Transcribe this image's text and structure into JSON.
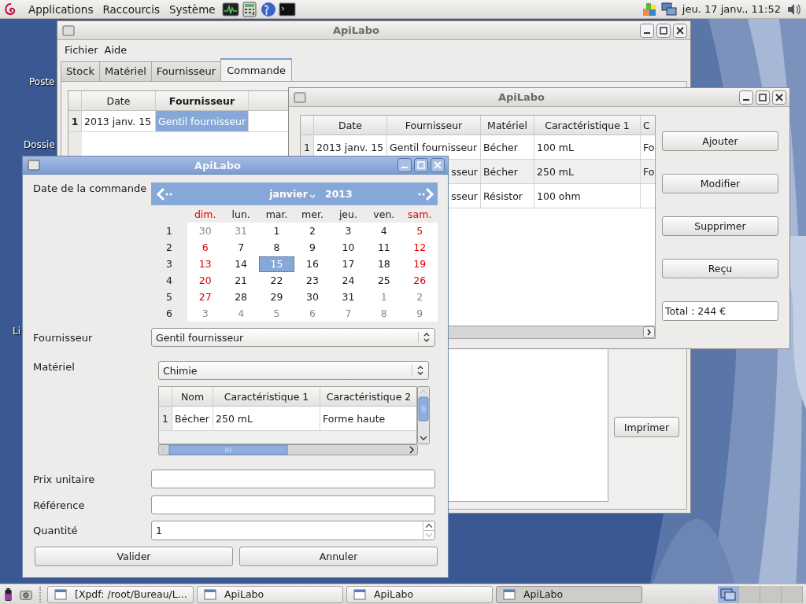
{
  "top_panel": {
    "menus": [
      "Applications",
      "Raccourcis",
      "Système"
    ],
    "clock": "jeu. 17 janv., 11:52"
  },
  "desktop_icons": [
    {
      "label": "Poste"
    },
    {
      "label": "Dossie"
    },
    {
      "label": "Li"
    }
  ],
  "main_window": {
    "title": "ApiLabo",
    "menu": [
      "Fichier",
      "Aide"
    ],
    "tabs": [
      {
        "label": "Stock",
        "selected": false
      },
      {
        "label": "Matériel",
        "selected": false
      },
      {
        "label": "Fournisseur",
        "selected": false
      },
      {
        "label": "Commande",
        "selected": true
      }
    ],
    "table": {
      "columns": [
        {
          "label": "Date",
          "selected": false
        },
        {
          "label": "Fournisseur",
          "selected": true
        }
      ],
      "rows": [
        {
          "number": "1",
          "selected": true,
          "cells": [
            {
              "text": "2013 janv. 15",
              "selected": false
            },
            {
              "text": "Gentil fournisseur",
              "selected": true
            }
          ]
        }
      ]
    },
    "print_button": "Imprimer"
  },
  "orders_window": {
    "title": "ApiLabo",
    "table": {
      "columns": [
        "Date",
        "Fournisseur",
        "Matériel",
        "Caractéristique 1",
        "C"
      ],
      "rows": [
        {
          "number": "1",
          "date": "2013 janv. 15",
          "supplier": "Gentil fournisseur",
          "material": "Bécher",
          "char1": "100 mL",
          "column_6": "Fo"
        },
        {
          "supplier": "sseur",
          "material": "Bécher",
          "char1": "250 mL",
          "column_6": "Fo"
        },
        {
          "supplier": "sseur",
          "material": "Résistor",
          "char1": "100 ohm"
        }
      ]
    },
    "buttons": [
      "Ajouter",
      "Modifier",
      "Supprimer",
      "Reçu"
    ],
    "total": "Total : 244 €"
  },
  "order_dialog": {
    "title": "ApiLabo",
    "date_label": "Date de la commande",
    "calendar": {
      "month": "janvier",
      "year": "2013",
      "weekdays": [
        {
          "label": "dim.",
          "weekend": true
        },
        {
          "label": "lun.",
          "weekend": false
        },
        {
          "label": "mar.",
          "weekend": false
        },
        {
          "label": "mer.",
          "weekend": false
        },
        {
          "label": "jeu.",
          "weekend": false
        },
        {
          "label": "ven.",
          "weekend": false
        },
        {
          "label": "sam.",
          "weekend": true
        }
      ],
      "weeks": [
        {
          "number": "1",
          "days": [
            {
              "d": "30",
              "other_month": true,
              "selected": false
            },
            {
              "d": "31",
              "other_month": true,
              "selected": false
            },
            {
              "d": "1",
              "other_month": false,
              "selected": false
            },
            {
              "d": "2",
              "other_month": false,
              "selected": false
            },
            {
              "d": "3",
              "other_month": false,
              "selected": false
            },
            {
              "d": "4",
              "other_month": false,
              "selected": false
            },
            {
              "d": "5",
              "other_month": false,
              "selected": false
            }
          ]
        },
        {
          "number": "2",
          "days": [
            {
              "d": "6",
              "other_month": false,
              "selected": false
            },
            {
              "d": "7",
              "other_month": false,
              "selected": false
            },
            {
              "d": "8",
              "other_month": false,
              "selected": false
            },
            {
              "d": "9",
              "other_month": false,
              "selected": false
            },
            {
              "d": "10",
              "other_month": false,
              "selected": false
            },
            {
              "d": "11",
              "other_month": false,
              "selected": false
            },
            {
              "d": "12",
              "other_month": false,
              "selected": false
            }
          ]
        },
        {
          "number": "3",
          "days": [
            {
              "d": "13",
              "other_month": false,
              "selected": false
            },
            {
              "d": "14",
              "other_month": false,
              "selected": false
            },
            {
              "d": "15",
              "other_month": false,
              "selected": true
            },
            {
              "d": "16",
              "other_month": false,
              "selected": false
            },
            {
              "d": "17",
              "other_month": false,
              "selected": false
            },
            {
              "d": "18",
              "other_month": false,
              "selected": false
            },
            {
              "d": "19",
              "other_month": false,
              "selected": false
            }
          ]
        },
        {
          "number": "4",
          "days": [
            {
              "d": "20",
              "other_month": false,
              "selected": false
            },
            {
              "d": "21",
              "other_month": false,
              "selected": false
            },
            {
              "d": "22",
              "other_month": false,
              "selected": false
            },
            {
              "d": "23",
              "other_month": false,
              "selected": false
            },
            {
              "d": "24",
              "other_month": false,
              "selected": false
            },
            {
              "d": "25",
              "other_month": false,
              "selected": false
            },
            {
              "d": "26",
              "other_month": false,
              "selected": false
            }
          ]
        },
        {
          "number": "5",
          "days": [
            {
              "d": "27",
              "other_month": false,
              "selected": false
            },
            {
              "d": "28",
              "other_month": false,
              "selected": false
            },
            {
              "d": "29",
              "other_month": false,
              "selected": false
            },
            {
              "d": "30",
              "other_month": false,
              "selected": false
            },
            {
              "d": "31",
              "other_month": false,
              "selected": false
            },
            {
              "d": "1",
              "other_month": true,
              "selected": false
            },
            {
              "d": "2",
              "other_month": true,
              "selected": false
            }
          ]
        },
        {
          "number": "6",
          "days": [
            {
              "d": "3",
              "other_month": true,
              "selected": false
            },
            {
              "d": "4",
              "other_month": true,
              "selected": false
            },
            {
              "d": "5",
              "other_month": true,
              "selected": false
            },
            {
              "d": "6",
              "other_month": true,
              "selected": false
            },
            {
              "d": "7",
              "other_month": true,
              "selected": false
            },
            {
              "d": "8",
              "other_month": true,
              "selected": false
            },
            {
              "d": "9",
              "other_month": true,
              "selected": false
            }
          ]
        }
      ]
    },
    "supplier_label": "Fournisseur",
    "supplier_value": "Gentil fournisseur",
    "material_label": "Matériel",
    "category_value": "Chimie",
    "material_table": {
      "columns": [
        "Nom",
        "Caractéristique 1",
        "Caractéristique 2"
      ],
      "rows": [
        {
          "number": "1",
          "cells": [
            "Bécher",
            "250 mL",
            "Forme haute"
          ]
        }
      ]
    },
    "fields": [
      {
        "label": "Prix unitaire",
        "kind": "text"
      },
      {
        "label": "Référence",
        "kind": "text"
      },
      {
        "label": "Quantité",
        "kind": "spin",
        "value": "1"
      }
    ],
    "buttons": [
      "Valider",
      "Annuler"
    ]
  },
  "taskbar": {
    "tasks": [
      {
        "label": "[Xpdf: /root/Bureau/L...",
        "selected": false
      },
      {
        "label": "ApiLabo",
        "selected": false
      },
      {
        "label": "ApiLabo",
        "selected": false
      },
      {
        "label": "ApiLabo",
        "selected": true
      }
    ],
    "workspaces": [
      {
        "selected": true
      },
      {
        "selected": false
      },
      {
        "selected": false
      },
      {
        "selected": false
      }
    ]
  }
}
